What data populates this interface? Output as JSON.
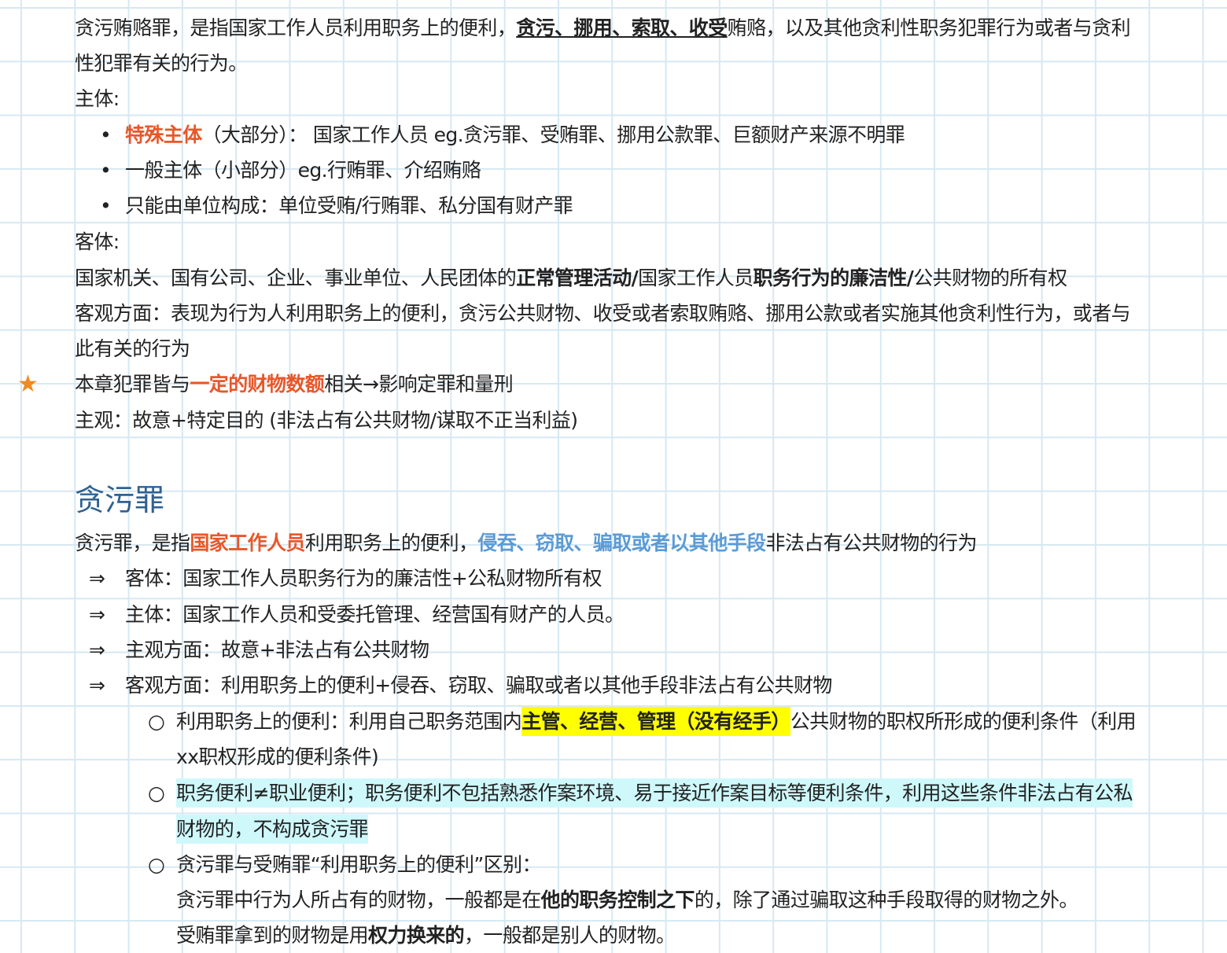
{
  "heading": "贪污罪",
  "markers": {
    "bullet": "•",
    "arrow": "⇒",
    "circle": "○",
    "star": "★"
  },
  "colors": {
    "orange": "#e8572a",
    "blue": "#5b9bd5",
    "heading": "#2f6190",
    "star": "#f08a24",
    "highlight_yellow": "#ffff00",
    "highlight_cyan": "#cff8fb"
  },
  "lines": [
    {
      "level": 0,
      "marker": null,
      "runs": [
        {
          "t": "贪污贿赂罪，是指国家工作人员利用职务上的便利，",
          "s": "plain"
        },
        {
          "t": "贪污、挪用、索取、收受",
          "s": "bold-underline"
        },
        {
          "t": "贿赂，以及其他贪利性职务犯罪行为或者与贪利",
          "s": "plain"
        }
      ]
    },
    {
      "level": 0,
      "marker": null,
      "runs": [
        {
          "t": "性犯罪有关的行为。",
          "s": "plain"
        }
      ]
    },
    {
      "level": 0,
      "marker": null,
      "runs": [
        {
          "t": "主体:",
          "s": "plain"
        }
      ]
    },
    {
      "level": 1,
      "marker": "bullet",
      "runs": [
        {
          "t": "特殊主体",
          "s": "orange"
        },
        {
          "t": "（大部分）： 国家工作人员 eg.贪污罪、受贿罪、挪用公款罪、巨额财产来源不明罪",
          "s": "plain"
        }
      ]
    },
    {
      "level": 1,
      "marker": "bullet",
      "runs": [
        {
          "t": "一般主体（小部分）eg.行贿罪、介绍贿赂",
          "s": "plain"
        }
      ]
    },
    {
      "level": 1,
      "marker": "bullet",
      "runs": [
        {
          "t": "只能由单位构成：单位受贿/行贿罪、私分国有财产罪",
          "s": "plain"
        }
      ]
    },
    {
      "level": 0,
      "marker": null,
      "runs": [
        {
          "t": "客体:",
          "s": "plain"
        }
      ]
    },
    {
      "level": 0,
      "marker": null,
      "runs": [
        {
          "t": "国家机关、国有公司、企业、事业单位、人民团体的",
          "s": "plain"
        },
        {
          "t": "正常管理活动/",
          "s": "bold"
        },
        {
          "t": "国家工作人员",
          "s": "plain"
        },
        {
          "t": "职务行为的廉洁性/",
          "s": "bold"
        },
        {
          "t": "公共财物的所有权",
          "s": "plain"
        }
      ]
    },
    {
      "level": 0,
      "marker": null,
      "runs": [
        {
          "t": "客观方面：表现为行为人利用职务上的便利，贪污公共财物、收受或者索取贿赂、挪用公款或者实施其他贪利性行为，或者与",
          "s": "plain"
        }
      ]
    },
    {
      "level": 0,
      "marker": null,
      "runs": [
        {
          "t": "此有关的行为",
          "s": "plain"
        }
      ]
    },
    {
      "level": 0,
      "marker": "star",
      "runs": [
        {
          "t": "本章犯罪皆与",
          "s": "plain"
        },
        {
          "t": "一定的财物数额",
          "s": "orange"
        },
        {
          "t": "相关→影响定罪和量刑",
          "s": "plain"
        }
      ]
    },
    {
      "level": 0,
      "marker": null,
      "runs": [
        {
          "t": "主观：故意+特定目的 (非法占有公共财物/谋取不正当利益)",
          "s": "plain"
        }
      ]
    },
    {
      "level": 0,
      "marker": null,
      "runs": [
        {
          "t": "贪污罪，是指",
          "s": "plain"
        },
        {
          "t": "国家工作人员",
          "s": "orange"
        },
        {
          "t": "利用职务上的便利，",
          "s": "plain"
        },
        {
          "t": "侵吞、窃取、骗取或者以其他手段",
          "s": "blue"
        },
        {
          "t": "非法占有公共财物的行为",
          "s": "plain"
        }
      ]
    },
    {
      "level": 1,
      "marker": "arrow",
      "runs": [
        {
          "t": "客体：国家工作人员职务行为的廉洁性+公私财物所有权",
          "s": "plain"
        }
      ]
    },
    {
      "level": 1,
      "marker": "arrow",
      "runs": [
        {
          "t": "主体：国家工作人员和受委托管理、经营国有财产的人员。",
          "s": "plain"
        }
      ]
    },
    {
      "level": 1,
      "marker": "arrow",
      "runs": [
        {
          "t": "主观方面：故意+非法占有公共财物",
          "s": "plain"
        }
      ]
    },
    {
      "level": 1,
      "marker": "arrow",
      "runs": [
        {
          "t": "客观方面：利用职务上的便利+侵吞、窃取、骗取或者以其他手段非法占有公共财物",
          "s": "plain"
        }
      ]
    },
    {
      "level": 2,
      "marker": "circle",
      "runs": [
        {
          "t": "利用职务上的便利：利用自己职务范围内",
          "s": "plain"
        },
        {
          "t": "主管、经营、管理（没有经手）",
          "s": "hl-yellow"
        },
        {
          "t": "公共财物的职权所形成的便利条件（利用",
          "s": "plain"
        }
      ]
    },
    {
      "level": 2,
      "marker": null,
      "runs": [
        {
          "t": "xx职权形成的便利条件)",
          "s": "plain"
        }
      ]
    },
    {
      "level": 2,
      "marker": "circle",
      "runs": [
        {
          "t": "职务便利≠职业便利；职务便利不包括熟悉作案环境、易于接近作案目标等便利条件，利用这些条件非法占有公私",
          "s": "hl-cyan"
        }
      ]
    },
    {
      "level": 2,
      "marker": null,
      "runs": [
        {
          "t": "财物的，不构成贪污罪",
          "s": "hl-cyan"
        }
      ]
    },
    {
      "level": 2,
      "marker": "circle",
      "runs": [
        {
          "t": "贪污罪与受贿罪“利用职务上的便利”区别：",
          "s": "plain"
        }
      ]
    },
    {
      "level": 2,
      "marker": null,
      "runs": [
        {
          "t": "贪污罪中行为人所占有的财物，一般都是在",
          "s": "plain"
        },
        {
          "t": "他的职务控制之下",
          "s": "bold"
        },
        {
          "t": "的，除了通过骗取这种手段取得的财物之外。",
          "s": "plain"
        }
      ]
    },
    {
      "level": 2,
      "marker": null,
      "runs": [
        {
          "t": "受贿罪拿到的财物是用",
          "s": "plain"
        },
        {
          "t": "权力换来的",
          "s": "bold"
        },
        {
          "t": "，一般都是别人的财物。",
          "s": "plain"
        }
      ]
    }
  ]
}
